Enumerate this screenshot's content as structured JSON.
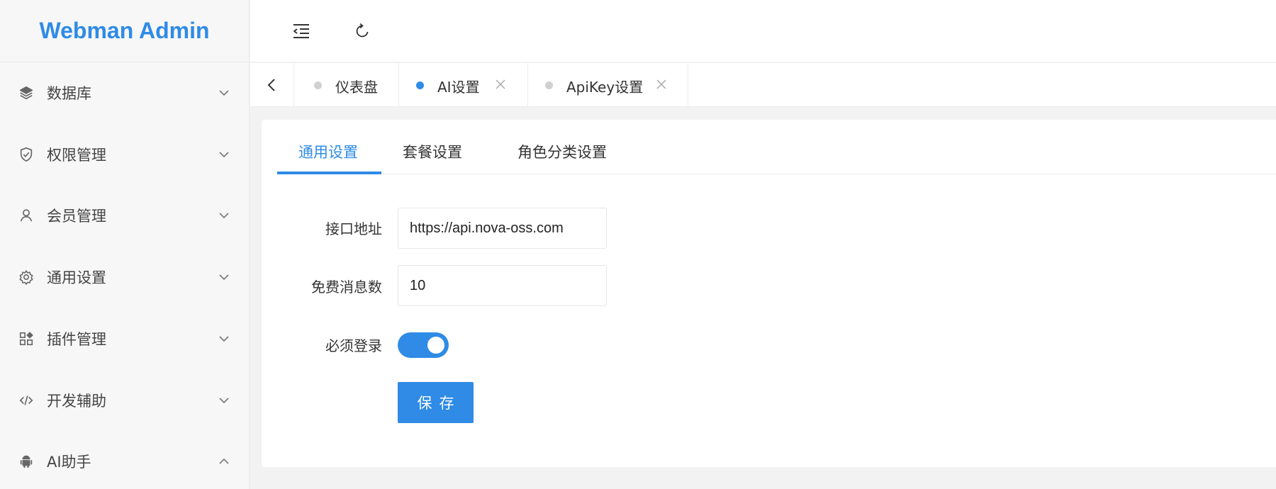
{
  "app": {
    "title": "Webman Admin"
  },
  "sidebar": {
    "items": [
      {
        "label": "数据库",
        "icon": "layers-icon",
        "expanded": false
      },
      {
        "label": "权限管理",
        "icon": "shield-check-icon",
        "expanded": false
      },
      {
        "label": "会员管理",
        "icon": "user-icon",
        "expanded": false
      },
      {
        "label": "通用设置",
        "icon": "gear-icon",
        "expanded": false
      },
      {
        "label": "插件管理",
        "icon": "apps-icon",
        "expanded": false
      },
      {
        "label": "开发辅助",
        "icon": "code-icon",
        "expanded": false
      },
      {
        "label": "AI助手",
        "icon": "android-icon",
        "expanded": true
      }
    ]
  },
  "topbar": {
    "icons": [
      "menu-fold-icon",
      "refresh-icon"
    ]
  },
  "tabs": [
    {
      "label": "仪表盘",
      "active": false,
      "closable": false
    },
    {
      "label": "AI设置",
      "active": true,
      "closable": true
    },
    {
      "label": "ApiKey设置",
      "active": false,
      "closable": true
    }
  ],
  "subtabs": [
    {
      "label": "通用设置",
      "active": true
    },
    {
      "label": "套餐设置",
      "active": false
    },
    {
      "label": "角色分类设置",
      "active": false
    }
  ],
  "form": {
    "api_url": {
      "label": "接口地址",
      "value": "https://api.nova-oss.com"
    },
    "free_messages": {
      "label": "免费消息数",
      "value": "10"
    },
    "require_login": {
      "label": "必须登录",
      "enabled": true
    },
    "save_label": "保存"
  },
  "colors": {
    "accent": "#2f8be6",
    "inactive_dot": "#d0d0d0"
  }
}
